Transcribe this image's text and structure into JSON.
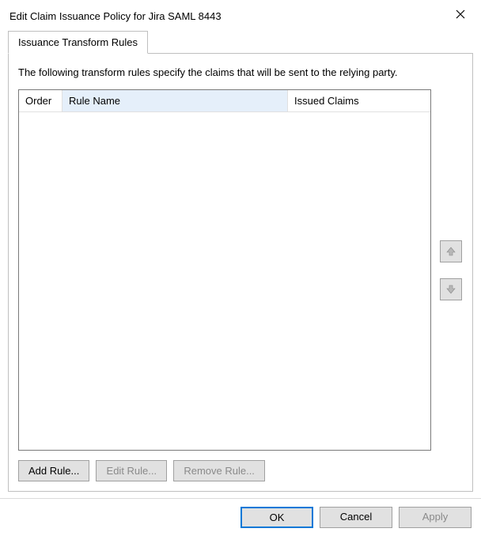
{
  "window": {
    "title": "Edit Claim Issuance Policy for Jira SAML 8443"
  },
  "tabs": {
    "transform_rules": "Issuance Transform Rules"
  },
  "description": "The following transform rules specify the claims that will be sent to the relying party.",
  "columns": {
    "order": "Order",
    "rule_name": "Rule Name",
    "issued_claims": "Issued Claims"
  },
  "rule_buttons": {
    "add": "Add Rule...",
    "edit": "Edit Rule...",
    "remove": "Remove Rule..."
  },
  "dialog_buttons": {
    "ok": "OK",
    "cancel": "Cancel",
    "apply": "Apply"
  }
}
